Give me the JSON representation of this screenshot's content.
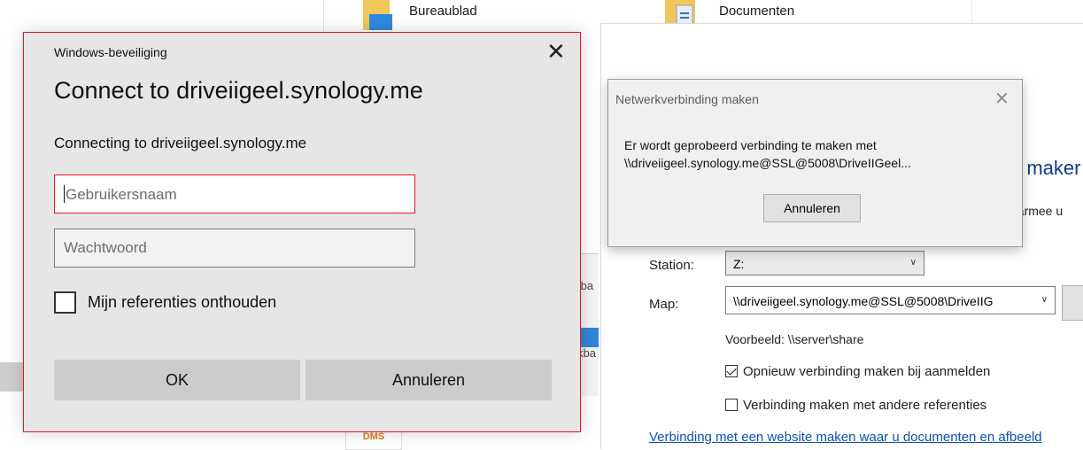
{
  "explorer": {
    "folders": [
      {
        "label": "Bureaublad",
        "icon": "desktop-folder-icon"
      },
      {
        "label": "Documenten",
        "icon": "documents-folder-icon"
      }
    ],
    "strip_texts": [
      "tba",
      "kba"
    ],
    "logo_text": "DMS"
  },
  "wizard": {
    "heading": "g maker",
    "subtext": "aarmee u",
    "station_label": "Station:",
    "station_value": "Z:",
    "map_label": "Map:",
    "map_value": "\\\\driveiigeel.synology.me@SSL@5008\\DriveIIG",
    "example": "Voorbeeld: \\\\server\\share",
    "reconnect_label": "Opnieuw verbinding maken bij aanmelden",
    "reconnect_checked": true,
    "other_creds_label": "Verbinding maken met andere referenties",
    "other_creds_checked": false,
    "website_link": "Verbinding met een website maken waar u documenten en afbeeld"
  },
  "net_dialog": {
    "title": "Netwerkverbinding maken",
    "message_line1": "Er wordt geprobeerd verbinding te maken met",
    "message_line2": "\\\\driveiigeel.synology.me@SSL@5008\\DriveIIGeel...",
    "cancel_label": "Annuleren"
  },
  "security_dialog": {
    "app_title": "Windows-beveiliging",
    "title": "Connect to driveiigeel.synology.me",
    "subtitle": "Connecting to driveiigeel.synology.me",
    "username_placeholder": "Gebruikersnaam",
    "password_placeholder": "Wachtwoord",
    "remember_label": "Mijn referenties onthouden",
    "remember_checked": false,
    "ok_label": "OK",
    "cancel_label": "Annuleren",
    "accent": "#e81123"
  }
}
